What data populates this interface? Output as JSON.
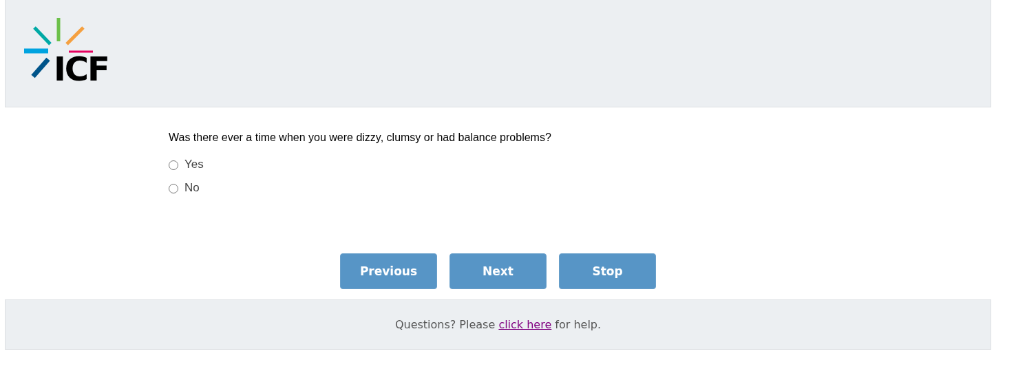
{
  "header": {
    "logo_text": "ICF"
  },
  "question": {
    "text": "Was there ever a time when you were dizzy, clumsy or had balance problems?",
    "options": [
      {
        "label": "Yes",
        "selected": false
      },
      {
        "label": "No",
        "selected": false
      }
    ]
  },
  "buttons": [
    {
      "label": "Previous"
    },
    {
      "label": "Next"
    },
    {
      "label": "Stop"
    }
  ],
  "footer": {
    "before": "Questions? Please ",
    "link": "click here",
    "after": " for help."
  }
}
